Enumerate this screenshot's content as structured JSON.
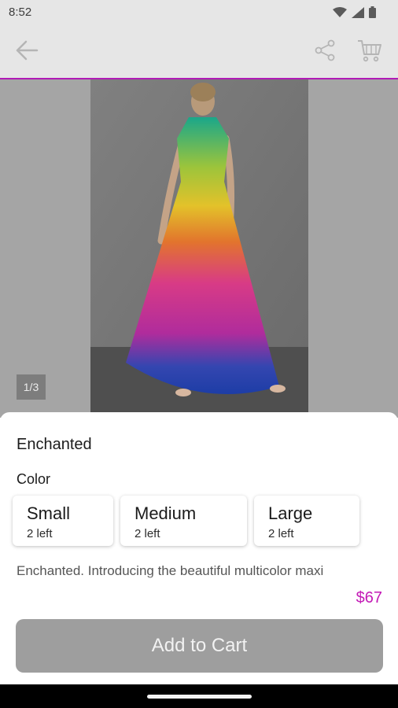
{
  "status_bar": {
    "time": "8:52",
    "icons": [
      "wifi-icon",
      "signal-icon",
      "battery-icon"
    ]
  },
  "app_bar": {
    "back_icon": "arrow-left-icon",
    "share_icon": "share-icon",
    "cart_icon": "cart-icon",
    "accent_color": "#b11bb6"
  },
  "gallery": {
    "page_indicator": "1/3"
  },
  "product": {
    "title": "Enchanted",
    "option_label": "Color",
    "sizes": [
      {
        "name": "Small",
        "stock": "2 left"
      },
      {
        "name": "Medium",
        "stock": "2 left"
      },
      {
        "name": "Large",
        "stock": "2 left"
      }
    ],
    "description": "Enchanted. Introducing the beautiful multicolor maxi",
    "price": "$67",
    "price_color": "#c31ab6"
  },
  "actions": {
    "add_to_cart_label": "Add to Cart"
  }
}
